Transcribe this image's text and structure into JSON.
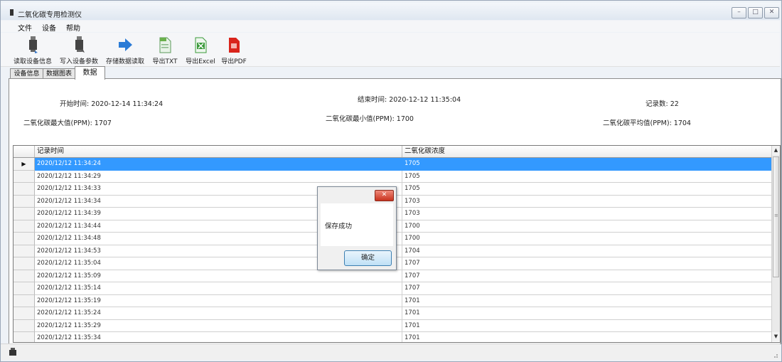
{
  "window": {
    "title": "二氧化碳专用检测仪"
  },
  "menu": {
    "items": [
      "文件",
      "设备",
      "帮助"
    ]
  },
  "toolbar": {
    "buttons": [
      {
        "label": "读取设备信息",
        "icon": "usb-drive-icon"
      },
      {
        "label": "写入设备参数",
        "icon": "usb-drive-write-icon"
      },
      {
        "label": "存储数据读取",
        "icon": "blue-arrow-icon"
      },
      {
        "label": "导出TXT",
        "icon": "green-document-icon"
      },
      {
        "label": "导出Excel",
        "icon": "excel-icon"
      },
      {
        "label": "导出PDF",
        "icon": "pdf-icon"
      }
    ]
  },
  "tabs": [
    {
      "label": "设备信息",
      "active": false
    },
    {
      "label": "数据图表",
      "active": false
    },
    {
      "label": "数据",
      "active": true
    }
  ],
  "summary": {
    "start_time": "开始时间: 2020-12-14 11:34:24",
    "end_time": "结束时间: 2020-12-12 11:35:04",
    "record_count": "记录数: 22",
    "co2_max": "二氧化碳最大值(PPM): 1707",
    "co2_min": "二氧化碳最小值(PPM): 1700",
    "co2_avg": "二氧化碳平均值(PPM): 1704"
  },
  "table": {
    "columns": [
      "记录时间",
      "二氧化碳浓度"
    ],
    "selected_index": 0,
    "rows": [
      [
        "2020/12/12 11:34:24",
        "1705"
      ],
      [
        "2020/12/12 11:34:29",
        "1705"
      ],
      [
        "2020/12/12 11:34:33",
        "1705"
      ],
      [
        "2020/12/12 11:34:34",
        "1703"
      ],
      [
        "2020/12/12 11:34:39",
        "1703"
      ],
      [
        "2020/12/12 11:34:44",
        "1700"
      ],
      [
        "2020/12/12 11:34:48",
        "1700"
      ],
      [
        "2020/12/12 11:34:53",
        "1704"
      ],
      [
        "2020/12/12 11:35:04",
        "1707"
      ],
      [
        "2020/12/12 11:35:09",
        "1707"
      ],
      [
        "2020/12/12 11:35:14",
        "1707"
      ],
      [
        "2020/12/12 11:35:19",
        "1701"
      ],
      [
        "2020/12/12 11:35:24",
        "1701"
      ],
      [
        "2020/12/12 11:35:29",
        "1701"
      ],
      [
        "2020/12/12 11:35:34",
        "1701"
      ]
    ]
  },
  "dialog": {
    "message": "保存成功",
    "ok_label": "确定",
    "close_glyph": "✕"
  },
  "window_controls": {
    "minimize": "–",
    "maximize": "□",
    "close": "✕"
  },
  "colors": {
    "selection": "#3399ff",
    "pdf_red": "#d9251c",
    "excel_green": "#3a9a3a"
  }
}
